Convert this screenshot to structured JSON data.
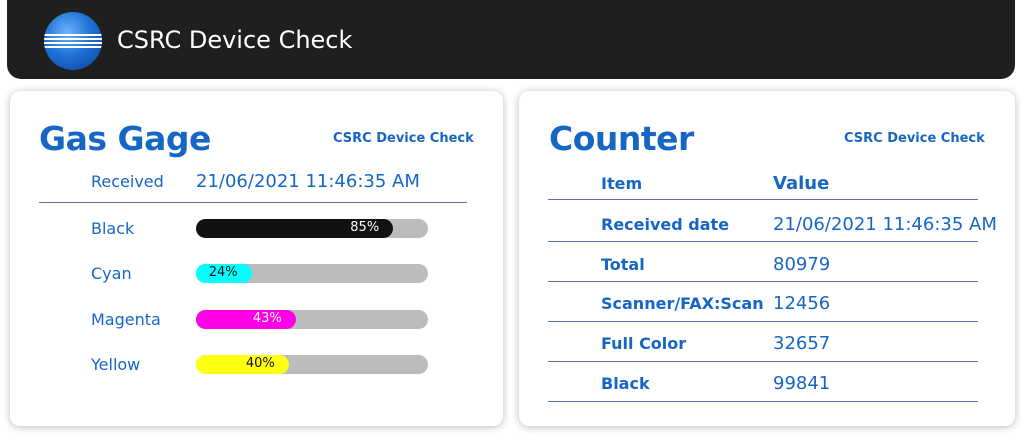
{
  "header": {
    "title": "CSRC Device Check"
  },
  "gas_gage": {
    "title": "Gas Gage",
    "subtitle": "CSRC Device Check",
    "received_label": "Received",
    "received_value": "21/06/2021 11:46:35 AM",
    "toners": [
      {
        "name": "Black",
        "percent": 85,
        "percent_label": "85%",
        "color": "#111111",
        "text_color": "#ffffff"
      },
      {
        "name": "Cyan",
        "percent": 24,
        "percent_label": "24%",
        "color": "#00ffff",
        "text_color": "#111111"
      },
      {
        "name": "Magenta",
        "percent": 43,
        "percent_label": "43%",
        "color": "#ff00e6",
        "text_color": "#ffffff"
      },
      {
        "name": "Yellow",
        "percent": 40,
        "percent_label": "40%",
        "color": "#ffff14",
        "text_color": "#111111"
      }
    ]
  },
  "counter": {
    "title": "Counter",
    "subtitle": "CSRC Device Check",
    "columns": [
      "Item",
      "Value"
    ],
    "rows": [
      {
        "item": "Received date",
        "value": "21/06/2021 11:46:35 AM"
      },
      {
        "item": "Total",
        "value": "80979"
      },
      {
        "item": "Scanner/FAX:Scan",
        "value": "12456"
      },
      {
        "item": "Full Color",
        "value": "32657"
      },
      {
        "item": "Black",
        "value": "99841"
      }
    ]
  }
}
